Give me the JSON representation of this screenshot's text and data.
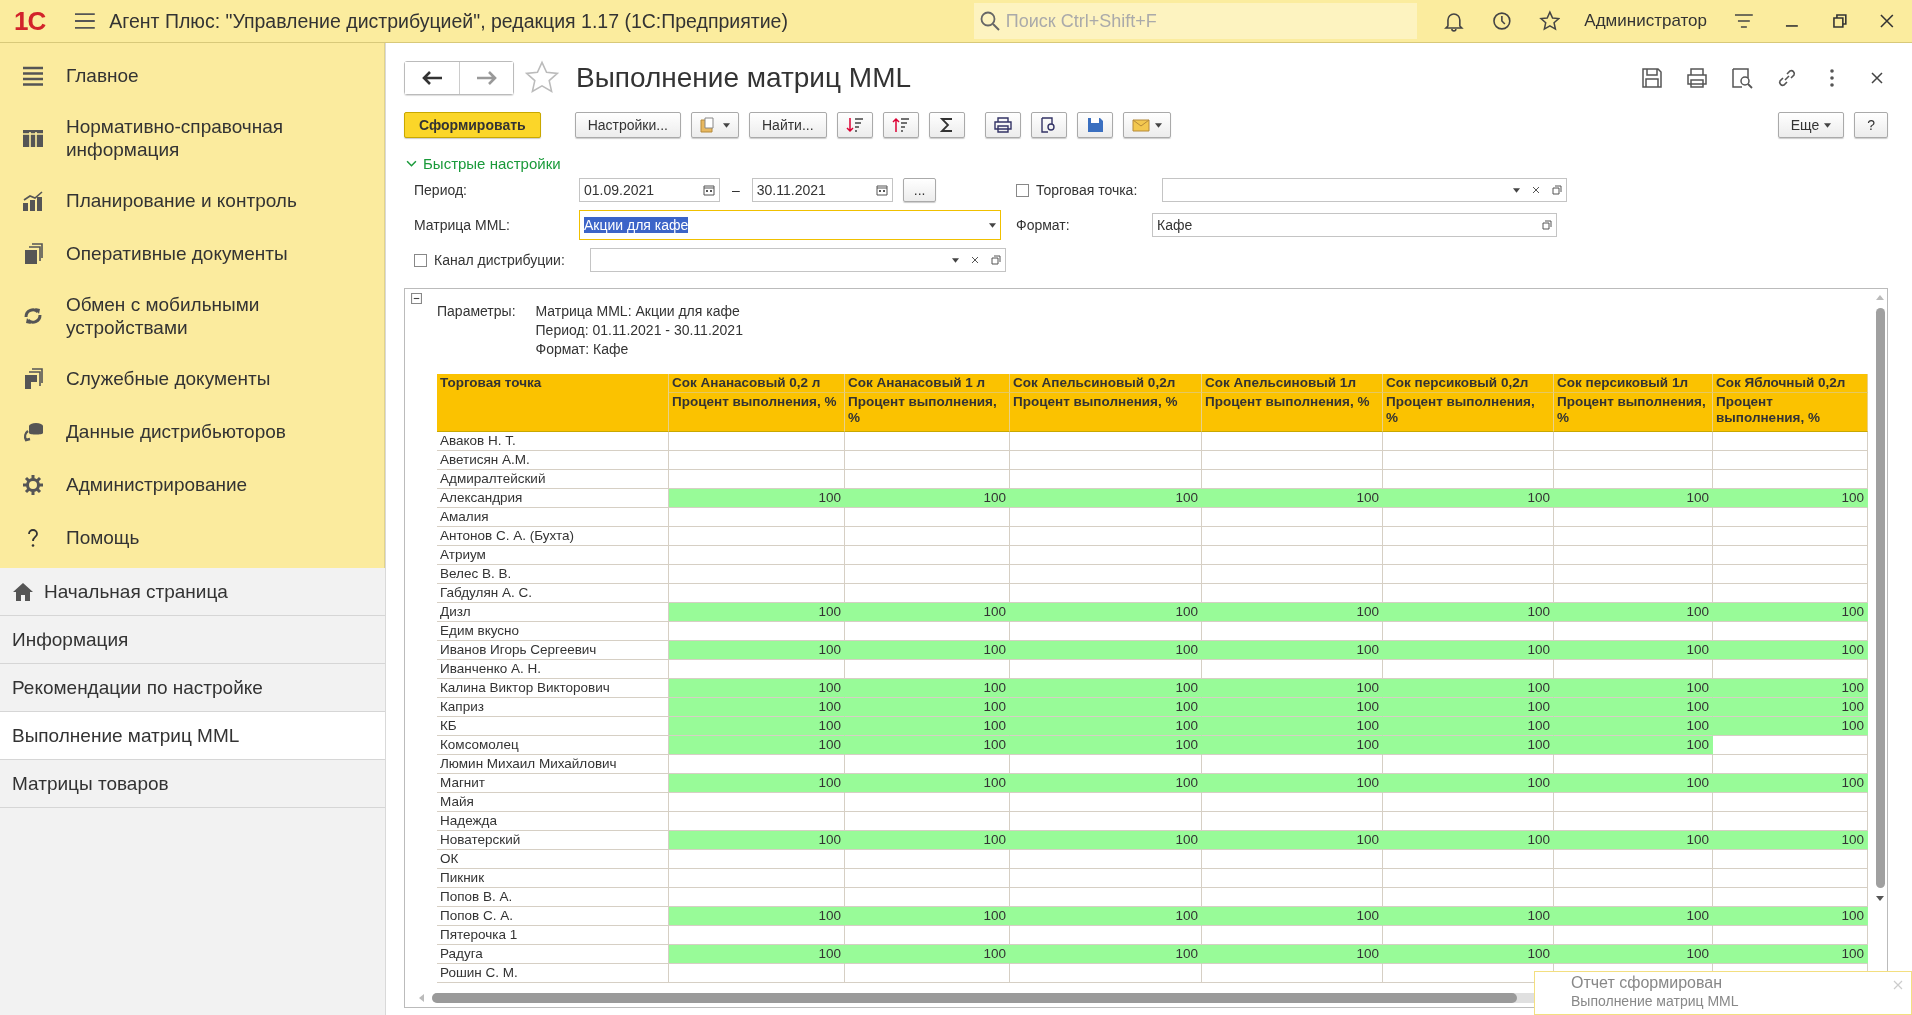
{
  "app": {
    "logo": "1С",
    "title": "Агент Плюс: \"Управление дистрибуцией\", редакция 1.17  (1С:Предприятие)",
    "search_placeholder": "Поиск Ctrl+Shift+F",
    "user": "Администратор"
  },
  "sidebar": {
    "sections": [
      {
        "label": "Главное"
      },
      {
        "label": "Нормативно-справочная информация"
      },
      {
        "label": "Планирование и контроль"
      },
      {
        "label": "Оперативные документы"
      },
      {
        "label": "Обмен с мобильными устройствами"
      },
      {
        "label": "Служебные документы"
      },
      {
        "label": "Данные дистрибьюторов"
      },
      {
        "label": "Администрирование"
      },
      {
        "label": "Помощь"
      }
    ],
    "pages": [
      {
        "label": "Начальная страница",
        "kind": "home",
        "selected": false
      },
      {
        "label": "Информация",
        "kind": "page",
        "selected": false
      },
      {
        "label": "Рекомендации по настройке",
        "kind": "page",
        "selected": false
      },
      {
        "label": "Выполнение матриц MML",
        "kind": "page",
        "selected": true
      },
      {
        "label": "Матрицы товаров",
        "kind": "page",
        "selected": false
      }
    ]
  },
  "form": {
    "title": "Выполнение матриц MML",
    "generate": "Сформировать",
    "settings": "Настройки...",
    "find": "Найти...",
    "more": "Еще",
    "help": "?"
  },
  "quick_settings": {
    "title": "Быстрые настройки",
    "expanded": true,
    "period": {
      "label": "Период:",
      "from": "01.09.2021",
      "dash": "–",
      "to": "30.11.2021",
      "choose": "..."
    },
    "matrix": {
      "label": "Матрица MML:",
      "value": "Акции для кафе"
    },
    "channel": {
      "label": "Канал дистрибуции:",
      "checked": false
    },
    "outlet": {
      "label": "Торговая точка:",
      "checked": false
    },
    "format": {
      "label": "Формат:",
      "value": "Кафе"
    }
  },
  "report": {
    "params_label": "Параметры:",
    "params": [
      "Матрица MML: Акции для кафе",
      "Период: 01.11.2021 - 30.11.2021",
      "Формат: Кафе"
    ],
    "first_column": "Торговая точка",
    "columns": [
      {
        "product": "Сок Ананасовый 0,2 л",
        "measure": "Процент выполнения, %"
      },
      {
        "product": "Сок Ананасовый 1 л",
        "measure": "Процент выполнения, %"
      },
      {
        "product": "Сок Апельсиновый 0,2л",
        "measure": "Процент выполнения, %"
      },
      {
        "product": "Сок Апельсиновый 1л",
        "measure": "Процент выполнения, %"
      },
      {
        "product": "Сок персиковый 0,2л",
        "measure": "Процент выполнения, %"
      },
      {
        "product": "Сок персиковый 1л",
        "measure": "Процент выполнения, %"
      },
      {
        "product": "Сок Яблочный 0,2л",
        "measure": "Процент выполнения, %"
      }
    ],
    "rows": [
      {
        "name": "Аваков Н. Т."
      },
      {
        "name": "Аветисян А.М."
      },
      {
        "name": "Адмиралтейский"
      },
      {
        "name": "Александрия",
        "values": [
          "100",
          "100",
          "100",
          "100",
          "100",
          "100",
          "100"
        ]
      },
      {
        "name": "Амалия"
      },
      {
        "name": "Антонов С. А. (Бухта)"
      },
      {
        "name": "Атриум"
      },
      {
        "name": "Велес В. В."
      },
      {
        "name": "Габдулян А. С."
      },
      {
        "name": "Дизл",
        "values": [
          "100",
          "100",
          "100",
          "100",
          "100",
          "100",
          "100"
        ]
      },
      {
        "name": "Едим вкусно"
      },
      {
        "name": "Иванов Игорь Сергеевич",
        "values": [
          "100",
          "100",
          "100",
          "100",
          "100",
          "100",
          "100"
        ]
      },
      {
        "name": "Иванченко А. Н."
      },
      {
        "name": "Калина Виктор Викторович",
        "values": [
          "100",
          "100",
          "100",
          "100",
          "100",
          "100",
          "100"
        ]
      },
      {
        "name": "Каприз",
        "values": [
          "100",
          "100",
          "100",
          "100",
          "100",
          "100",
          "100"
        ]
      },
      {
        "name": "КБ",
        "values": [
          "100",
          "100",
          "100",
          "100",
          "100",
          "100",
          "100"
        ]
      },
      {
        "name": "Комсомолец",
        "values": [
          "100",
          "100",
          "100",
          "100",
          "100",
          "100"
        ]
      },
      {
        "name": "Люмин Михаил Михайлович"
      },
      {
        "name": "Магнит",
        "values": [
          "100",
          "100",
          "100",
          "100",
          "100",
          "100",
          "100"
        ]
      },
      {
        "name": "Майя"
      },
      {
        "name": "Надежда"
      },
      {
        "name": "Новатерский",
        "values": [
          "100",
          "100",
          "100",
          "100",
          "100",
          "100",
          "100"
        ]
      },
      {
        "name": "ОК"
      },
      {
        "name": "Пикник"
      },
      {
        "name": "Попов В. А."
      },
      {
        "name": "Попов С. А.",
        "values": [
          "100",
          "100",
          "100",
          "100",
          "100",
          "100",
          "100"
        ]
      },
      {
        "name": "Пятерочка 1"
      },
      {
        "name": "Радуга",
        "values": [
          "100",
          "100",
          "100",
          "100",
          "100",
          "100",
          "100"
        ]
      },
      {
        "name": "Рошин С. М."
      }
    ]
  },
  "toast": {
    "title": "Отчет сформирован",
    "text": "Выполнение матриц MML"
  }
}
